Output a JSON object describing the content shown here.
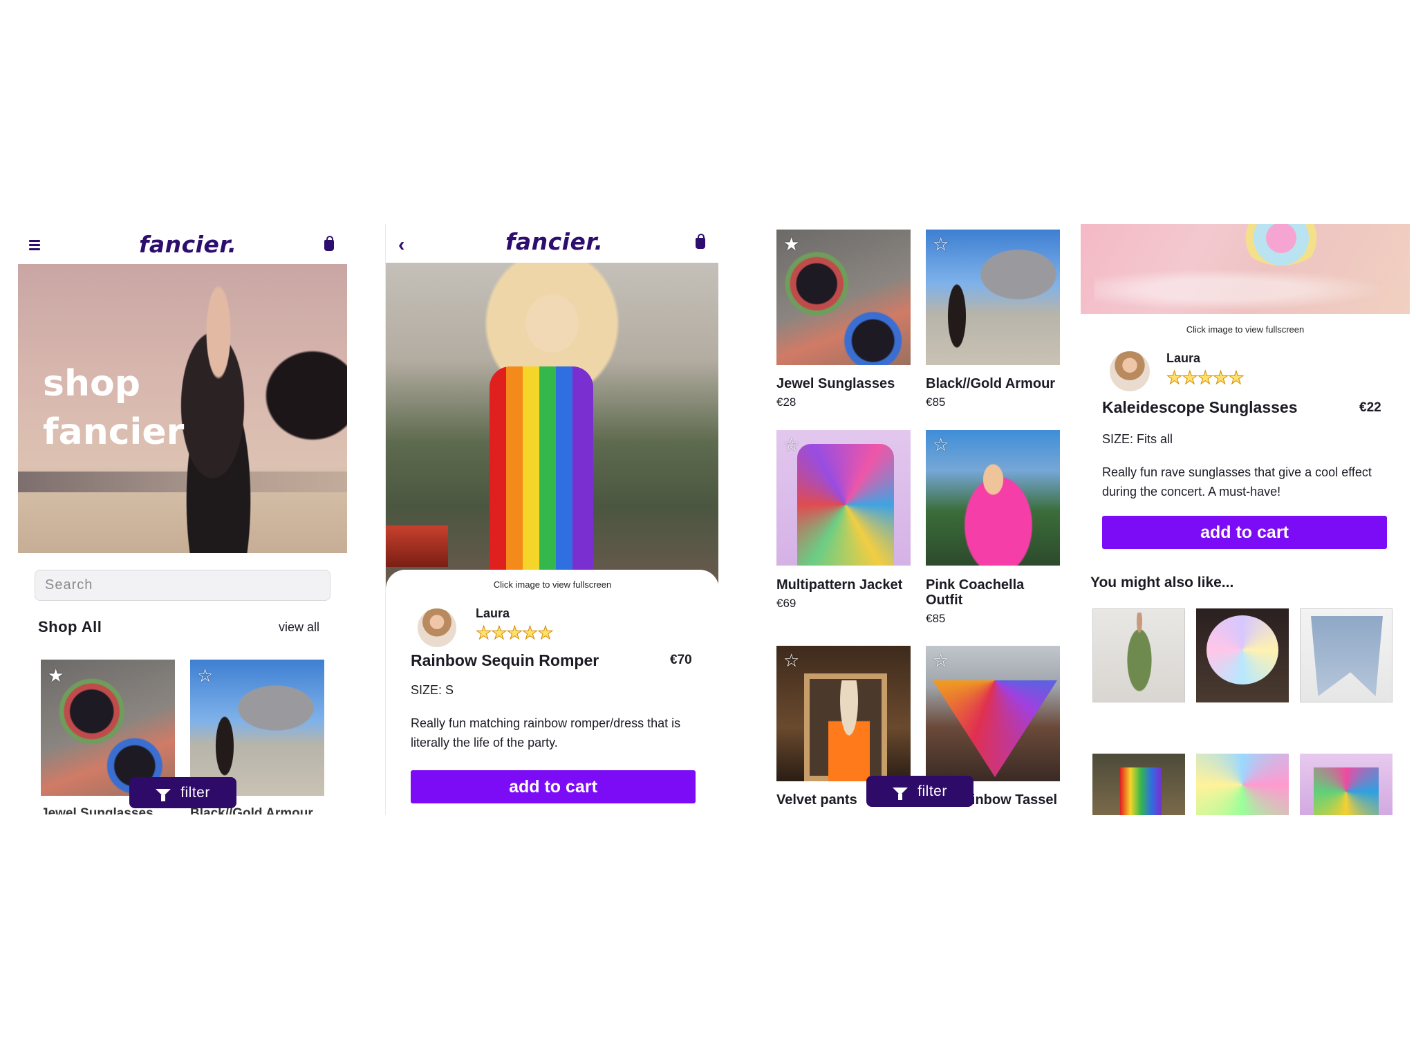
{
  "brand": "fancier.",
  "home": {
    "hero_text_line1": "shop",
    "hero_text_line2": "fancier",
    "search_placeholder": "Search",
    "section_title": "Shop All",
    "view_all": "view all",
    "cards": [
      {
        "name": "Jewel Sunglasses"
      },
      {
        "name": "Black//Gold Armour"
      }
    ],
    "filter_label": "filter"
  },
  "detail1": {
    "hint": "Click image to view fullscreen",
    "seller": "Laura",
    "rating": 5,
    "stars": "★★★★★",
    "title": "Rainbow Sequin Romper",
    "price": "€70",
    "size": "SIZE: S",
    "description": "Really fun matching rainbow romper/dress that is literally the life of the party.",
    "add_to_cart": "add to cart"
  },
  "grid": {
    "products": [
      {
        "name": "Jewel Sunglasses",
        "price": "€28",
        "favorited": true
      },
      {
        "name": "Black//Gold Armour",
        "price": "€85",
        "favorited": false
      },
      {
        "name": "Multipattern Jacket",
        "price": "€69",
        "favorited": false
      },
      {
        "name": "Pink Coachella Outfit",
        "price": "€85",
        "favorited": false
      },
      {
        "name": "Velvet pants",
        "price": "",
        "favorited": false
      },
      {
        "name": "Rainbow Tassel",
        "price": "",
        "favorited": false
      }
    ],
    "filter_label": "filter"
  },
  "detail2": {
    "hint": "Click image to view fullscreen",
    "seller": "Laura",
    "rating": 5,
    "stars": "★★★★★",
    "title": "Kaleidescope Sunglasses",
    "price": "€22",
    "size": "SIZE: Fits all",
    "description": "Really fun rave sunglasses that give a cool effect during the concert. A must-have!",
    "add_to_cart": "add to cart",
    "also_like": "You might also like..."
  },
  "colors": {
    "brand": "#2d0e6e",
    "accent": "#7b0cf5",
    "filter_bg": "#2e0a69",
    "star": "#ffb400"
  },
  "icons": [
    "menu-icon",
    "bag-icon",
    "back-chevron-icon",
    "star-icon",
    "filter-icon"
  ]
}
